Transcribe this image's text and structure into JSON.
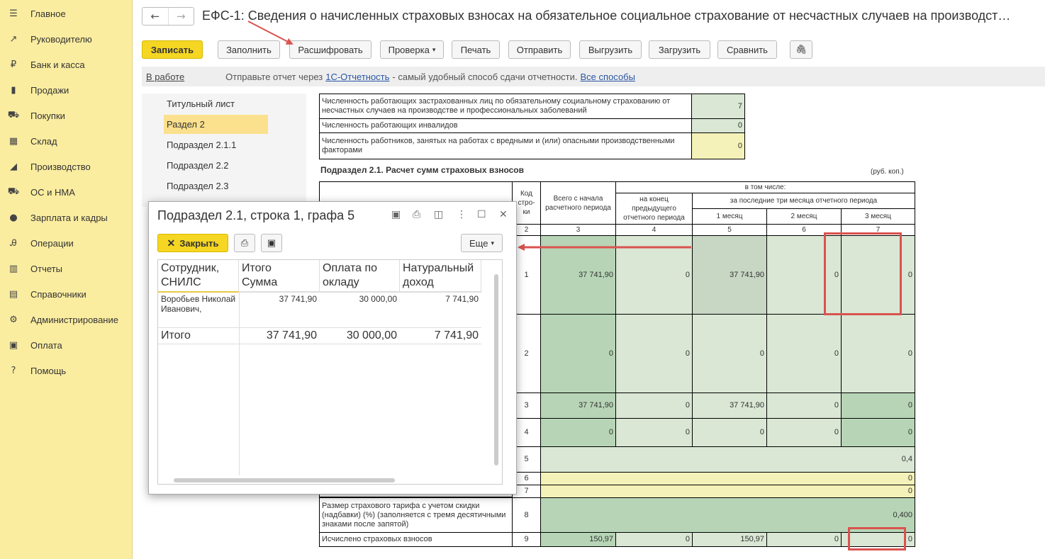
{
  "sidebar": {
    "items": [
      {
        "icon": "☰",
        "label": "Главное"
      },
      {
        "icon": "↗",
        "label": "Руководителю"
      },
      {
        "icon": "₽",
        "label": "Банк и касса"
      },
      {
        "icon": "▮",
        "label": "Продажи"
      },
      {
        "icon": "⛟",
        "label": "Покупки"
      },
      {
        "icon": "▦",
        "label": "Склад"
      },
      {
        "icon": "◢",
        "label": "Производство"
      },
      {
        "icon": "⛟",
        "label": "ОС и НМА"
      },
      {
        "icon": "●",
        "label": "Зарплата и кадры"
      },
      {
        "icon": "Ꭿ",
        "label": "Операции"
      },
      {
        "icon": "▥",
        "label": "Отчеты"
      },
      {
        "icon": "▤",
        "label": "Справочники"
      },
      {
        "icon": "⚙",
        "label": "Администрирование"
      },
      {
        "icon": "▣",
        "label": "Оплата"
      },
      {
        "icon": "?",
        "label": "Помощь"
      }
    ]
  },
  "header": {
    "back": "←",
    "forward": "→",
    "title": "ЕФС-1: Сведения о начисленных страховых взносах на обязательное социальное страхование от несчастных случаев на производст…"
  },
  "toolbar": {
    "save": "Записать",
    "fill": "Заполнить",
    "decode": "Расшифровать",
    "check": "Проверка",
    "check_arrow": "▾",
    "print": "Печать",
    "send": "Отправить",
    "upload": "Выгрузить",
    "download": "Загрузить",
    "compare": "Сравнить",
    "attach": "🖇"
  },
  "status": {
    "state": "В работе",
    "message": "Отправьте отчет через",
    "link": "1С-Отчетность",
    "message2": "- самый удобный способ сдачи отчетности.",
    "all_ways": "Все способы"
  },
  "sections": [
    "Титульный лист",
    "Раздел 2",
    "Подраздел 2.1.1",
    "Подраздел 2.2",
    "Подраздел 2.3"
  ],
  "report": {
    "row_insured": "Численность работающих застрахованных лиц по обязательному социальному страхованию от несчастных случаев на производстве и профессиональных заболеваний",
    "row_insured_val": "7",
    "row_disabled": "Численность работающих инвалидов",
    "row_disabled_val": "0",
    "row_harmful": "Численность работников, занятых на работах с вредными и (или) опасными производственными факторами",
    "row_harmful_val": "0",
    "subsection_title": "Подраздел 2.1. Расчет сумм страховых взносов",
    "units": "(руб. коп.)",
    "h_code": "Код стро-ки",
    "h_total": "Всего с начала расчетного периода",
    "h_incl": "в том числе:",
    "h_prev": "на конец предыдущего отчетного периода",
    "h_last3": "за последние три месяца отчетного периода",
    "h_m1": "1 месяц",
    "h_m2": "2 месяц",
    "h_m3": "3 месяц",
    "col_nums": [
      "2",
      "3",
      "4",
      "5",
      "6",
      "7"
    ],
    "rows": [
      {
        "code": "1",
        "total": "37 741,90",
        "prev": "0",
        "m1": "37 741,90",
        "m2": "0",
        "m3": "0"
      },
      {
        "code": "2",
        "total": "0",
        "prev": "0",
        "m1": "0",
        "m2": "0",
        "m3": "0"
      },
      {
        "code": "3",
        "total": "37 741,90",
        "prev": "0",
        "m1": "37 741,90",
        "m2": "0",
        "m3": "0"
      },
      {
        "code": "4",
        "total": "0",
        "prev": "0",
        "m1": "0",
        "m2": "0",
        "m3": "0"
      }
    ],
    "row5_code": "5",
    "row5_val": "0,4",
    "row6_code": "6",
    "row6_val": "0",
    "row7_code": "7",
    "row7_val": "0",
    "row8_label": "Размер страхового тарифа с учетом скидки (надбавки) (%) (заполняется с тремя десятичными знаками после запятой)",
    "row8_code": "8",
    "row8_val": "0,400",
    "row9_label": "Исчислено страховых взносов",
    "row9_code": "9",
    "row9": {
      "total": "150,97",
      "prev": "0",
      "m1": "150,97",
      "m2": "0",
      "m3": "0"
    }
  },
  "popup": {
    "title": "Подраздел 2.1, строка 1, графа 5",
    "close": "Закрыть",
    "more": "Еще",
    "more_arrow": "▾",
    "cols": [
      "Сотрудник, СНИЛС",
      "Итого\nСумма",
      "Оплата по окладу",
      "Натуральный доход"
    ],
    "rows": [
      {
        "employee": "Воробьев Николай Иванович,",
        "total": "37 741,90",
        "salary": "30 000,00",
        "natural": "7 741,90"
      }
    ],
    "footer": {
      "label": "Итого",
      "total": "37 741,90",
      "salary": "30 000,00",
      "natural": "7 741,90"
    }
  },
  "colors": {
    "sidebar_bg": "#fbeda0",
    "primary_btn": "#f5d623",
    "highlight": "#d9534f",
    "green_cell": "#b7d5b6",
    "yellow_cell": "#f4f2b8"
  }
}
